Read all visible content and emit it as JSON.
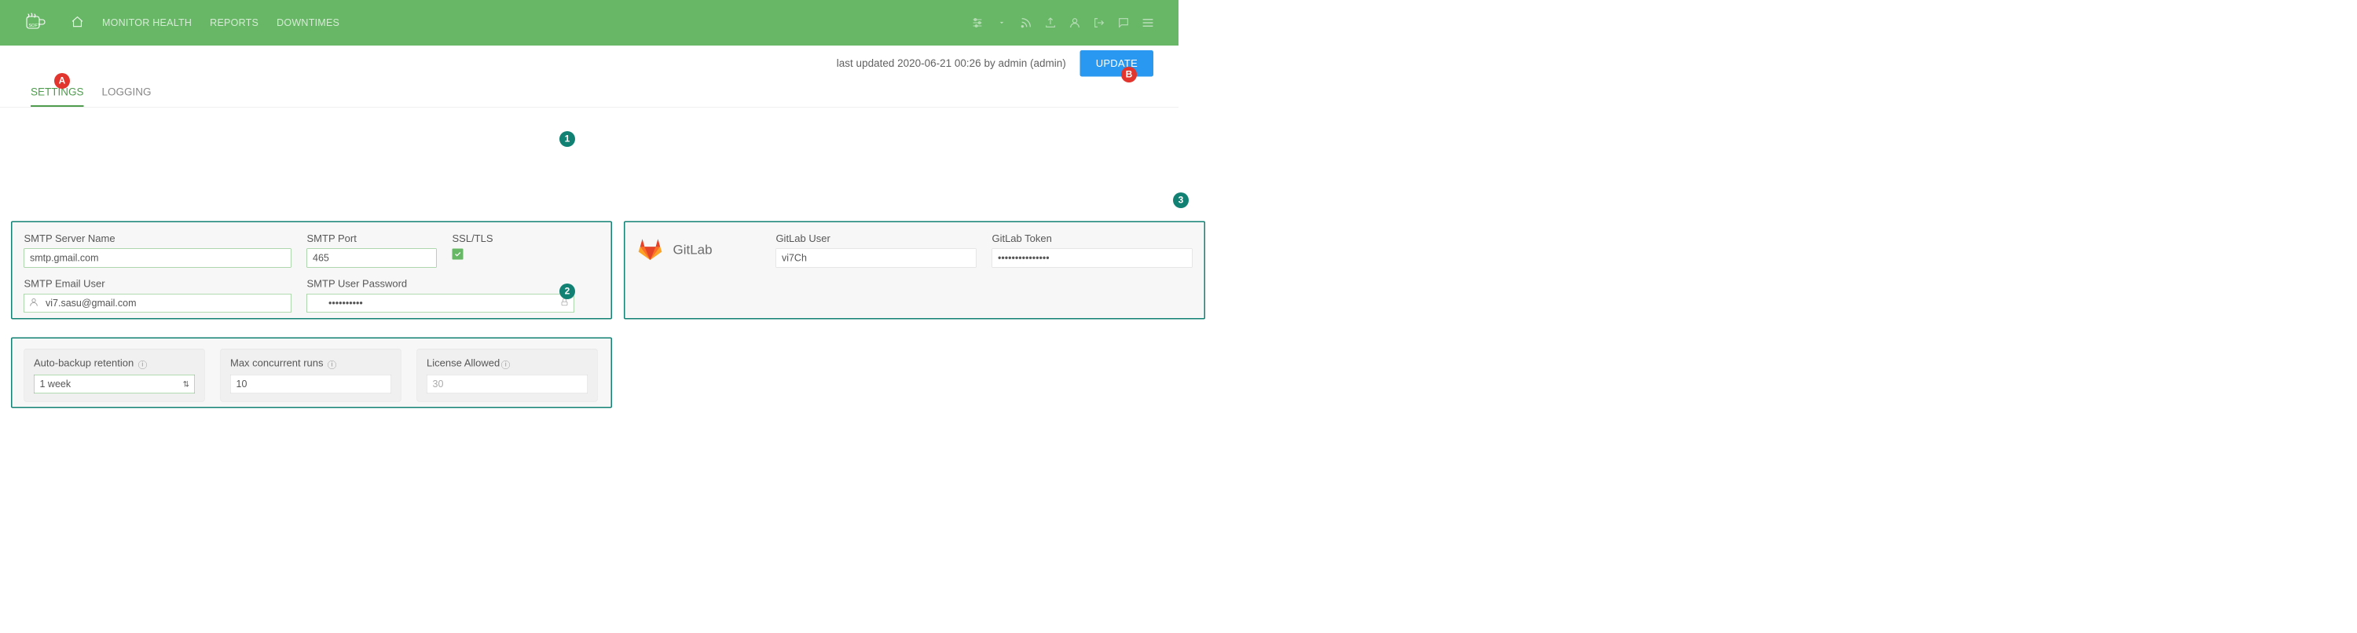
{
  "brand": "mugsoft",
  "nav": {
    "monitor": "MONITOR HEALTH",
    "reports": "REPORTS",
    "downtimes": "DOWNTIMES"
  },
  "subbar": {
    "stamp": "last updated 2020-06-21 00:26 by admin (admin)",
    "update": "UPDATE"
  },
  "tabs": {
    "settings": "SETTINGS",
    "logging": "LOGGING"
  },
  "annotations": {
    "A": "A",
    "B": "B",
    "n1": "1",
    "n2": "2",
    "n3": "3"
  },
  "smtp": {
    "server_label": "SMTP Server Name",
    "server_value": "smtp.gmail.com",
    "port_label": "SMTP Port",
    "port_value": "465",
    "ssl_label": "SSL/TLS",
    "user_label": "SMTP Email User",
    "user_value": "vi7.sasu@gmail.com",
    "pwd_label": "SMTP User Password",
    "pwd_value": "••••••••••"
  },
  "runtime": {
    "backup_label": "Auto-backup retention",
    "backup_value": "1 week",
    "conc_label": "Max concurrent runs",
    "conc_value": "10",
    "lic_label": "License Allowed",
    "lic_value": "30"
  },
  "gitlab": {
    "name": "GitLab",
    "user_label": "GitLab User",
    "user_value": "vi7Ch",
    "token_label": "GitLab Token",
    "token_value": "•••••••••••••••"
  }
}
